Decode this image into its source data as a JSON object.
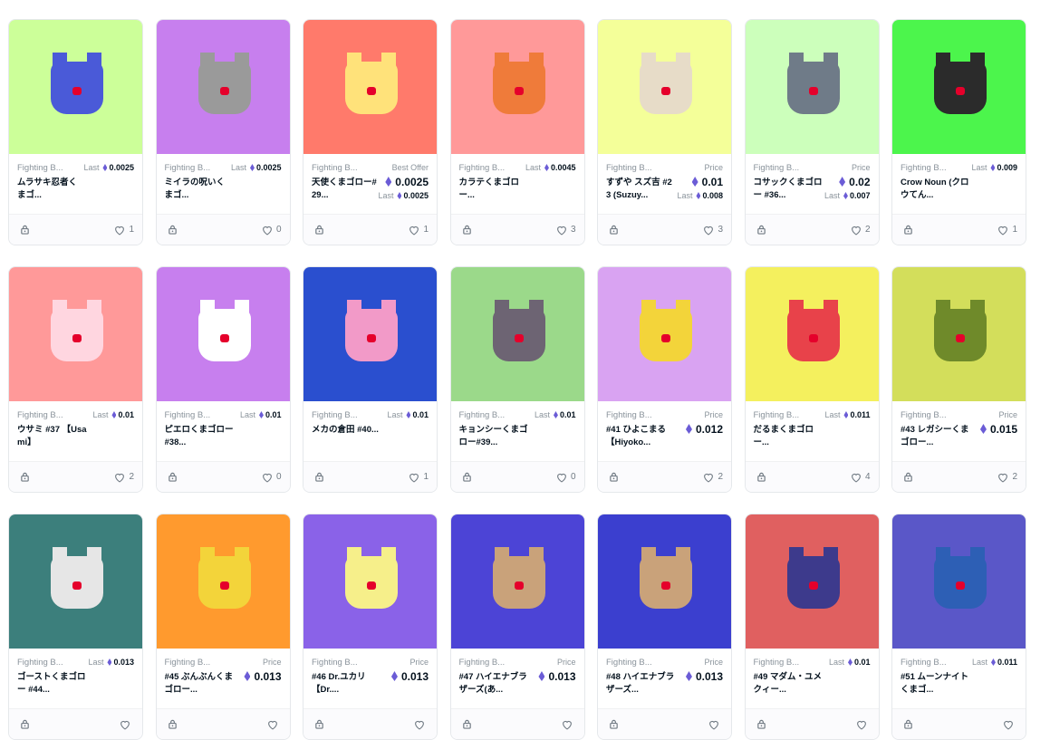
{
  "cards": [
    {
      "collection": "Fighting B...",
      "name": "ムラサキ忍者くまゴ...",
      "bg": "#ccff99",
      "char": "#4a5ad8",
      "label": "Last",
      "value": "0.0025",
      "favorites": "1"
    },
    {
      "collection": "Fighting B...",
      "name": "ミイラの呪いくまゴ...",
      "bg": "#c77fee",
      "char": "#9a9a9a",
      "label": "Last",
      "value": "0.0025",
      "favorites": "0"
    },
    {
      "collection": "Fighting B...",
      "name": "天使くまゴロー#29...",
      "bg": "#ff7a6b",
      "char": "#ffe27a",
      "label": "Best Offer",
      "value": "0.0025",
      "sub_label": "Last",
      "sub_value": "0.0025",
      "favorites": "1"
    },
    {
      "collection": "Fighting B...",
      "name": "カラテくまゴロー...",
      "bg": "#ff9999",
      "char": "#ef7b3a",
      "label": "Last",
      "value": "0.0045",
      "favorites": "3"
    },
    {
      "collection": "Fighting B...",
      "name": "すずや スズ吉 #23 (Suzuy...",
      "bg": "#f4ff99",
      "char": "#e7dcc8",
      "label": "Price",
      "value": "0.01",
      "sub_label": "Last",
      "sub_value": "0.008",
      "favorites": "3"
    },
    {
      "collection": "Fighting B...",
      "name": "コサックくまゴロー #36...",
      "bg": "#ccffbb",
      "char": "#6f7b88",
      "label": "Price",
      "value": "0.02",
      "sub_label": "Last",
      "sub_value": "0.007",
      "favorites": "2"
    },
    {
      "collection": "Fighting B...",
      "name": "Crow Noun (クロウてん...",
      "bg": "#4cf54c",
      "char": "#2b2b2b",
      "label": "Last",
      "value": "0.009",
      "favorites": "1"
    },
    {
      "collection": "Fighting B...",
      "name": "ウサミ #37 【Usami】",
      "bg": "#ff9999",
      "char": "#ffd6e0",
      "label": "Last",
      "value": "0.01",
      "favorites": "2"
    },
    {
      "collection": "Fighting B...",
      "name": "ピエロくまゴロー #38...",
      "bg": "#c77fee",
      "char": "#ffffff",
      "label": "Last",
      "value": "0.01",
      "favorites": "0"
    },
    {
      "collection": "Fighting B...",
      "name": "メカの倉田 #40...",
      "bg": "#2a4fcf",
      "char": "#f29ac8",
      "label": "Last",
      "value": "0.01",
      "favorites": "1"
    },
    {
      "collection": "Fighting B...",
      "name": "キョンシーくまゴロー#39...",
      "bg": "#9bd98a",
      "char": "#6d6473",
      "label": "Last",
      "value": "0.01",
      "favorites": "0"
    },
    {
      "collection": "Fighting B...",
      "name": "#41 ひよこまる 【Hiyoko...",
      "bg": "#d9a3f2",
      "char": "#f3d43a",
      "label": "Price",
      "value": "0.012",
      "favorites": "2"
    },
    {
      "collection": "Fighting B...",
      "name": "だるまくまゴロー...",
      "bg": "#f4f05e",
      "char": "#e8424a",
      "label": "Last",
      "value": "0.011",
      "favorites": "4"
    },
    {
      "collection": "Fighting B...",
      "name": "#43 レガシーくまゴロー...",
      "bg": "#d3de5b",
      "char": "#6f8a2a",
      "label": "Price",
      "value": "0.015",
      "favorites": "2"
    },
    {
      "collection": "Fighting B...",
      "name": "ゴーストくまゴロー #44...",
      "bg": "#3c7f7c",
      "char": "#e6e6e6",
      "label": "Last",
      "value": "0.013",
      "favorites": ""
    },
    {
      "collection": "Fighting B...",
      "name": "#45 ぶんぶんくまゴロー...",
      "bg": "#ff9a2e",
      "char": "#f3d43a",
      "label": "Price",
      "value": "0.013",
      "favorites": ""
    },
    {
      "collection": "Fighting B...",
      "name": "#46 Dr.ユカリ 【Dr....",
      "bg": "#8a62e8",
      "char": "#f6ef8a",
      "label": "Price",
      "value": "0.013",
      "favorites": ""
    },
    {
      "collection": "Fighting B...",
      "name": "#47 ハイエナブラザーズ(あ...",
      "bg": "#4c44d6",
      "char": "#c9a27a",
      "label": "Price",
      "value": "0.013",
      "favorites": ""
    },
    {
      "collection": "Fighting B...",
      "name": "#48 ハイエナブラザーズ...",
      "bg": "#3b3fcf",
      "char": "#c9a27a",
      "label": "Price",
      "value": "0.013",
      "favorites": ""
    },
    {
      "collection": "Fighting B...",
      "name": "#49 マダム・ユメクィー...",
      "bg": "#e06060",
      "char": "#3d3a8c",
      "label": "Last",
      "value": "0.01",
      "favorites": ""
    },
    {
      "collection": "Fighting B...",
      "name": "#51 ムーンナイトくまゴ...",
      "bg": "#5a57c8",
      "char": "#2d5fb5",
      "label": "Last",
      "value": "0.011",
      "favorites": ""
    }
  ]
}
